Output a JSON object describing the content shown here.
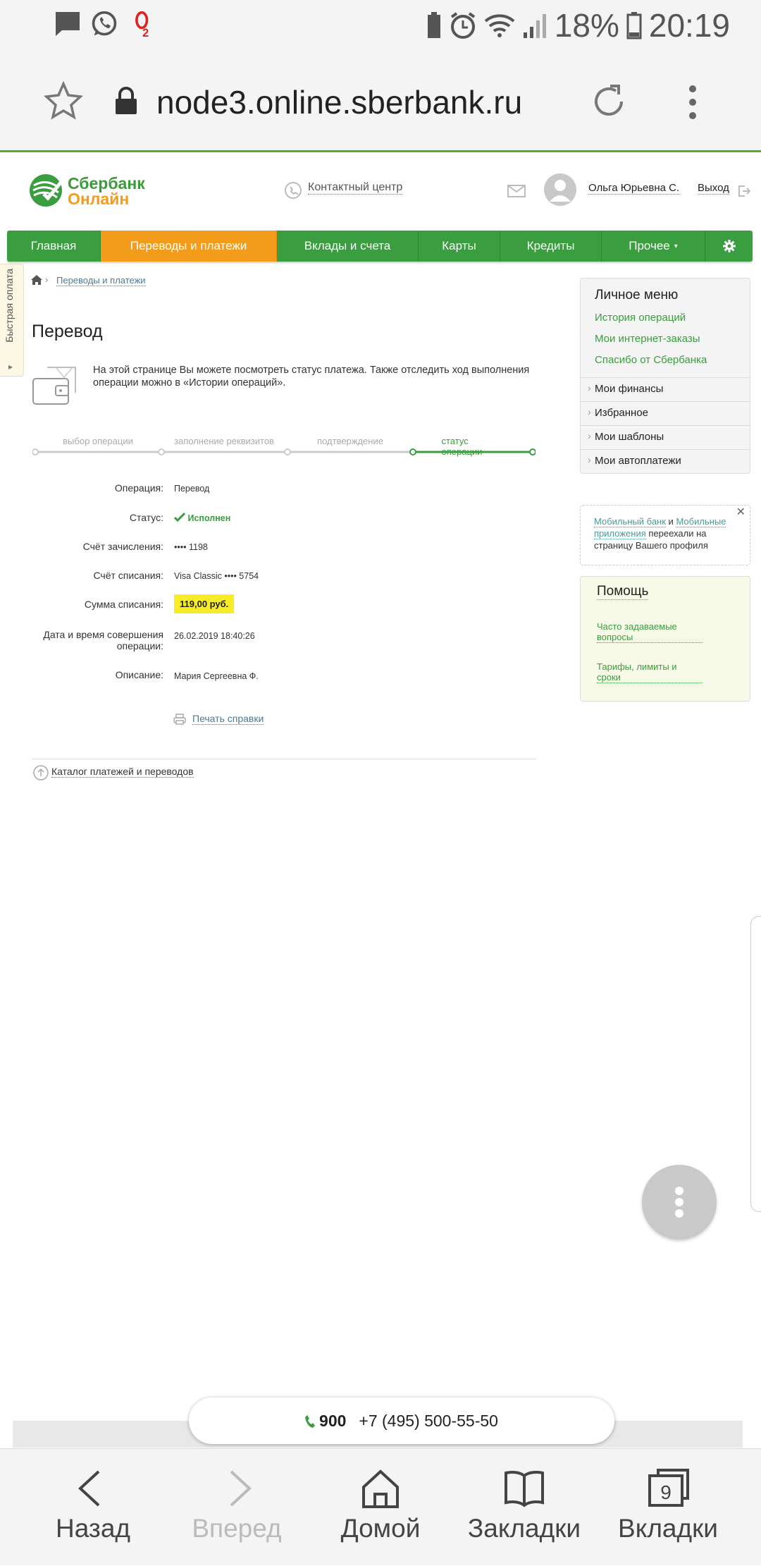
{
  "status_bar": {
    "battery": "18%",
    "time": "20:19"
  },
  "browser": {
    "url": "node3.online.sberbank.ru"
  },
  "header": {
    "logo_line1": "Сбербанк",
    "logo_line2": "Онлайн",
    "contact_center": "Контактный центр",
    "user_name": "Ольга Юрьевна С.",
    "logout": "Выход"
  },
  "main_menu": [
    "Главная",
    "Переводы и платежи",
    "Вклады и счета",
    "Карты",
    "Кредиты",
    "Прочее"
  ],
  "quick_pay": "Быстрая оплата",
  "breadcrumb": {
    "current": "Переводы и платежи"
  },
  "page_title": "Перевод",
  "intro_text": "На этой странице Вы можете посмотреть статус платежа. Также отследить ход выполнения операции можно в «Истории операций».",
  "steps": [
    "выбор операции",
    "заполнение реквизитов",
    "подтверждение",
    "статус операции"
  ],
  "details": {
    "operation_label": "Операция:",
    "operation_value": "Перевод",
    "status_label": "Статус:",
    "status_value": "Исполнен",
    "credit_account_label": "Счёт зачисления:",
    "credit_account_value": "•••• 1198",
    "debit_account_label": "Счёт списания:",
    "debit_account_value": "Visa Classic  •••• 5754",
    "amount_label": "Сумма списания:",
    "amount_value": "119,00 руб.",
    "datetime_label": "Дата и время совершения операции:",
    "datetime_value": "26.02.2019 18:40:26",
    "description_label": "Описание:",
    "description_value": "Мария Сергеевна Ф."
  },
  "print_link": "Печать справки",
  "catalog_link": "Каталог платежей и переводов",
  "personal_menu": {
    "title": "Личное меню",
    "links": [
      "История операций",
      "Мои интернет-заказы",
      "Спасибо от Сбербанка"
    ],
    "sections": [
      "Мои финансы",
      "Избранное",
      "Мои шаблоны",
      "Мои автоплатежи"
    ]
  },
  "notice": {
    "link1": "Мобильный банк",
    "and": "и",
    "link2": "Мобильные приложения",
    "rest": "переехали на страницу Вашего профиля"
  },
  "help": {
    "title": "Помощь",
    "faq": "Часто задаваемые вопросы",
    "tariffs": "Тарифы, лимиты и сроки"
  },
  "phones": {
    "short": "900",
    "long": "+7 (495) 500-55-50"
  },
  "bottom_nav": [
    "Назад",
    "Вперед",
    "Домой",
    "Закладки",
    "Вкладки"
  ],
  "tabs_count": "9",
  "colors": {
    "brand_green": "#3a9d3f",
    "active_orange": "#f39c1c",
    "amount_highlight": "#f7ec26"
  }
}
